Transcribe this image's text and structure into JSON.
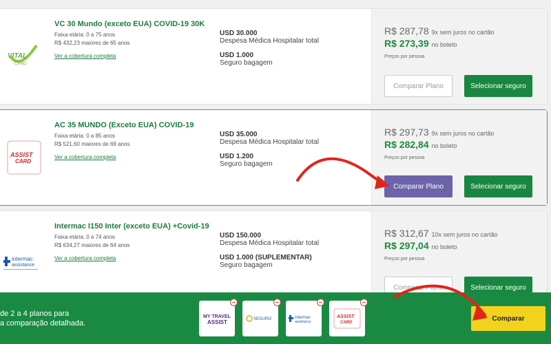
{
  "plans": [
    {
      "name": "VC 30 Mundo (exceto EUA) COVID-19 30K",
      "age_range": "Faixa etária: 0 a 75 anos",
      "senior_price": "R$ 432,23 maiores de 65 anos",
      "coverage_link": "Ver a cobertura completa",
      "medical_amount": "USD 30.000",
      "medical_label": "Despesa Médica Hospitalar total",
      "baggage_amount": "USD 1.000",
      "baggage_label": "Seguro bagagem",
      "card_price": "R$ 287,78",
      "card_terms": "9x sem juros no cartão",
      "boleto_price": "R$ 273,39",
      "boleto_label": "no boleto",
      "per_person": "Preços por pessoa",
      "compare_label": "Comparar Plano",
      "select_label": "Selecionar seguro",
      "logo_text": "VITAL CARD"
    },
    {
      "name": "AC 35 MUNDO (Exceto EUA) COVID-19",
      "age_range": "Faixa etária: 0 a 85 anos",
      "senior_price": "R$ 521,60 maiores de 69 anos",
      "coverage_link": "Ver a cobertura completa",
      "medical_amount": "USD 35.000",
      "medical_label": "Despesa Médica Hospitalar total",
      "baggage_amount": "USD 1.200",
      "baggage_label": "Seguro bagagem",
      "card_price": "R$ 297,73",
      "card_terms": "9x sem juros no cartão",
      "boleto_price": "R$ 282,84",
      "boleto_label": "no boleto",
      "per_person": "Preços por pessoa",
      "compare_label": "Comparar Plano",
      "select_label": "Selecionar seguro",
      "logo_text": "ASSIST CARD"
    },
    {
      "name": "Intermac I150 Inter (exceto EUA) +Covid-19",
      "age_range": "Faixa etária: 0 a 74 anos",
      "senior_price": "R$ 634,27 maiores de 64 anos",
      "coverage_link": "Ver a cobertura completa",
      "medical_amount": "USD 150.000",
      "medical_label": "Despesa Médica Hospitalar total",
      "baggage_amount": "USD 1.000 (SUPLEMENTAR)",
      "baggage_label": "Seguro bagagem",
      "card_price": "R$ 312,67",
      "card_terms": "10x sem juros no cartão",
      "boleto_price": "R$ 297,04",
      "boleto_label": "no boleto",
      "per_person": "Preços por pessoa",
      "compare_label": "Comparar Plano",
      "select_label": "Selecionar seguro",
      "logo_text": "intermac assistance"
    }
  ],
  "compare_bar": {
    "line1": "de 2 a 4 planos para",
    "line2": "a comparação detalhada.",
    "slots": [
      {
        "logo_text": "MY TRAVEL ASSIST"
      },
      {
        "logo_text": "SEGURO"
      },
      {
        "logo_text": "intermac assistance"
      },
      {
        "logo_text": "ASSIST CARD"
      }
    ],
    "compare_button": "Comparar"
  },
  "colors": {
    "brand_green": "#198741",
    "compare_active": "#6c63a9",
    "cta_yellow": "#f3d21d",
    "annotation_red": "#e0251b"
  }
}
